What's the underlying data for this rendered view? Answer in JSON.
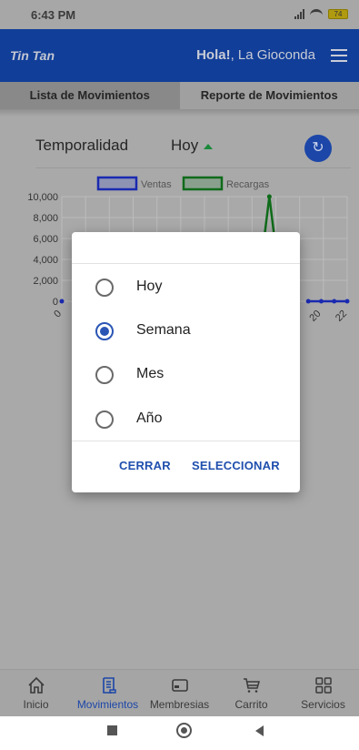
{
  "status_bar": {
    "time": "6:43 PM",
    "battery": "74"
  },
  "header": {
    "logo": "Tin Tan",
    "greeting_bold": "Hola!",
    "greeting_name": ", La Gioconda"
  },
  "tabs": [
    {
      "label": "Lista de Movimientos",
      "active": true
    },
    {
      "label": "Reporte de Movimientos",
      "active": false
    }
  ],
  "temporality": {
    "label": "Temporalidad",
    "value": "Hoy"
  },
  "chart_data": {
    "type": "line",
    "legend": [
      {
        "name": "Ventas",
        "color": "#1a2ab0"
      },
      {
        "name": "Recargas",
        "color": "#0f6b1a"
      }
    ],
    "y_ticks": [
      "10,000",
      "8,000",
      "6,000",
      "4,000",
      "2,000",
      "0"
    ],
    "ylim": [
      0,
      10000
    ],
    "x_tick_labels": [
      "0",
      "20",
      "22"
    ],
    "series": [
      {
        "name": "Ventas",
        "x": [
          19,
          20,
          21,
          22
        ],
        "values": [
          0,
          0,
          0,
          0
        ]
      },
      {
        "name": "Recargas",
        "x": [
          15,
          16,
          17
        ],
        "values": [
          0,
          10000,
          0
        ]
      }
    ]
  },
  "dialog": {
    "options": [
      {
        "label": "Hoy",
        "checked": false
      },
      {
        "label": "Semana",
        "checked": true
      },
      {
        "label": "Mes",
        "checked": false
      },
      {
        "label": "Año",
        "checked": false
      }
    ],
    "cancel_label": "CERRAR",
    "confirm_label": "SELECCIONAR"
  },
  "bottom_nav": [
    {
      "label": "Inicio",
      "icon": "home-icon",
      "active": false
    },
    {
      "label": "Movimientos",
      "icon": "receipt-icon",
      "active": true
    },
    {
      "label": "Membresias",
      "icon": "card-icon",
      "active": false
    },
    {
      "label": "Carrito",
      "icon": "cart-icon",
      "active": false
    },
    {
      "label": "Servicios",
      "icon": "grid-icon",
      "active": false
    }
  ]
}
